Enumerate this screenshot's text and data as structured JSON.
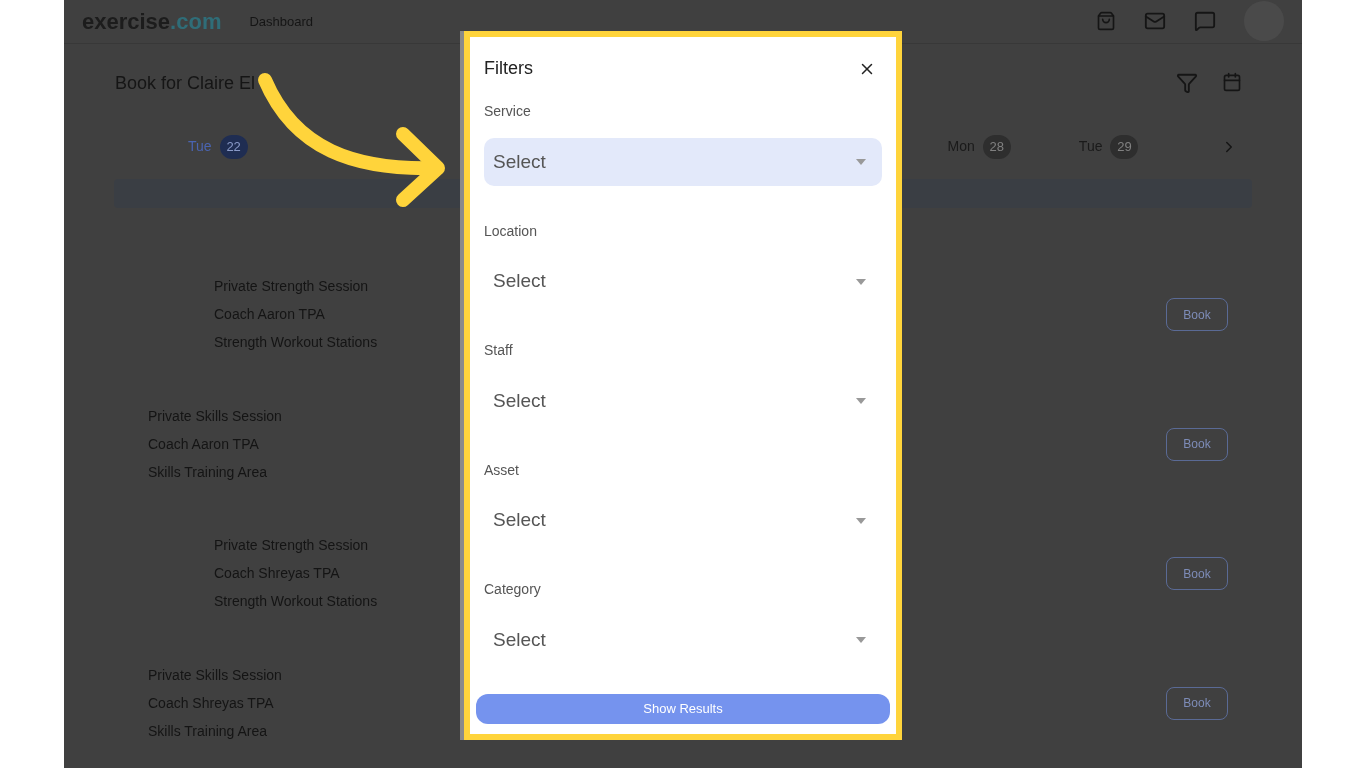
{
  "header": {
    "logo_main": "exercise",
    "logo_accent": ".com",
    "nav": [
      "Dashboard"
    ]
  },
  "page": {
    "title": "Book for Claire El"
  },
  "dates": [
    {
      "day": "Tue",
      "number": "22",
      "selected": true
    },
    {
      "day": "Mon",
      "number": "28",
      "selected": false
    },
    {
      "day": "Tue",
      "number": "29",
      "selected": false
    }
  ],
  "sessions": [
    {
      "indented": true,
      "lines": [
        "Private Strength Session",
        "Coach Aaron TPA",
        "Strength Workout Stations"
      ],
      "button": "Book"
    },
    {
      "indented": false,
      "lines": [
        "Private Skills Session",
        "Coach Aaron TPA",
        "Skills Training Area"
      ],
      "button": "Book"
    },
    {
      "indented": true,
      "lines": [
        "Private Strength Session",
        "Coach Shreyas TPA",
        "Strength Workout Stations"
      ],
      "button": "Book"
    },
    {
      "indented": false,
      "lines": [
        "Private Skills Session",
        "Coach Shreyas TPA",
        "Skills Training Area"
      ],
      "button": "Book"
    }
  ],
  "modal": {
    "title": "Filters",
    "fields": [
      {
        "label": "Service",
        "value": "Select",
        "focused": true
      },
      {
        "label": "Location",
        "value": "Select",
        "focused": false
      },
      {
        "label": "Staff",
        "value": "Select",
        "focused": false
      },
      {
        "label": "Asset",
        "value": "Select",
        "focused": false
      },
      {
        "label": "Category",
        "value": "Select",
        "focused": false
      }
    ],
    "button": "Show Results"
  }
}
